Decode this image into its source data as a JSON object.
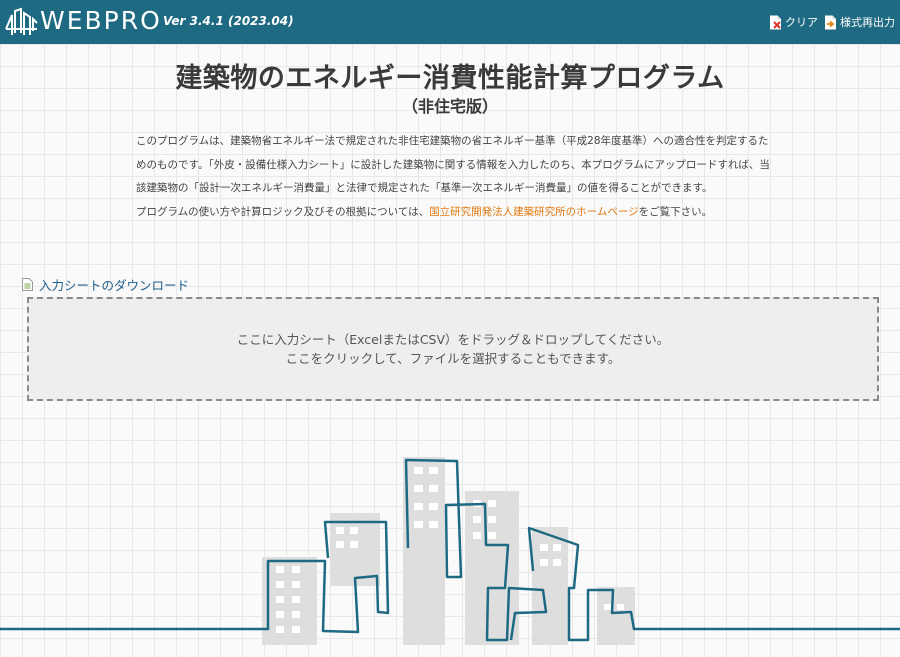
{
  "header": {
    "brand": "WEBPRO",
    "version": "Ver 3.4.1 (2023.04)",
    "clear_label": "クリア",
    "output_label": "様式再出力",
    "background_color": "#1e6a83"
  },
  "main": {
    "title": "建築物のエネルギー消費性能計算プログラム",
    "subtitle": "（非住宅版）",
    "description": {
      "paragraph1": "このプログラムは、建築物省エネルギー法で規定された非住宅建築物の省エネルギー基準（平成28年度基準）への適合性を判定するためのものです。「外皮・設備仕様入力シート」に設計した建築物に関する情報を入力したのち、本プログラムにアップロードすれば、当該建築物の「設計一次エネルギー消費量」と法律で規定された「基準一次エネルギー消費量」の値を得ることができます。",
      "paragraph2_before": "プログラムの使い方や計算ロジック及びその根拠については、",
      "paragraph2_link": "国立研究開発法人建築研究所のホームページ",
      "paragraph2_after": "をご覧下さい。",
      "link_color": "#e07a10"
    },
    "download_link": "入力シートのダウンロード",
    "dropzone": {
      "line1": "ここに入力シート（ExcelまたはCSV）をドラッグ＆ドロップしてください。",
      "line2": "ここをクリックして、ファイルを選択することもできます。"
    }
  },
  "icons": {
    "logo": "building-logo-icon",
    "clear": "document-clear-icon",
    "output": "document-output-icon",
    "download": "document-icon"
  }
}
